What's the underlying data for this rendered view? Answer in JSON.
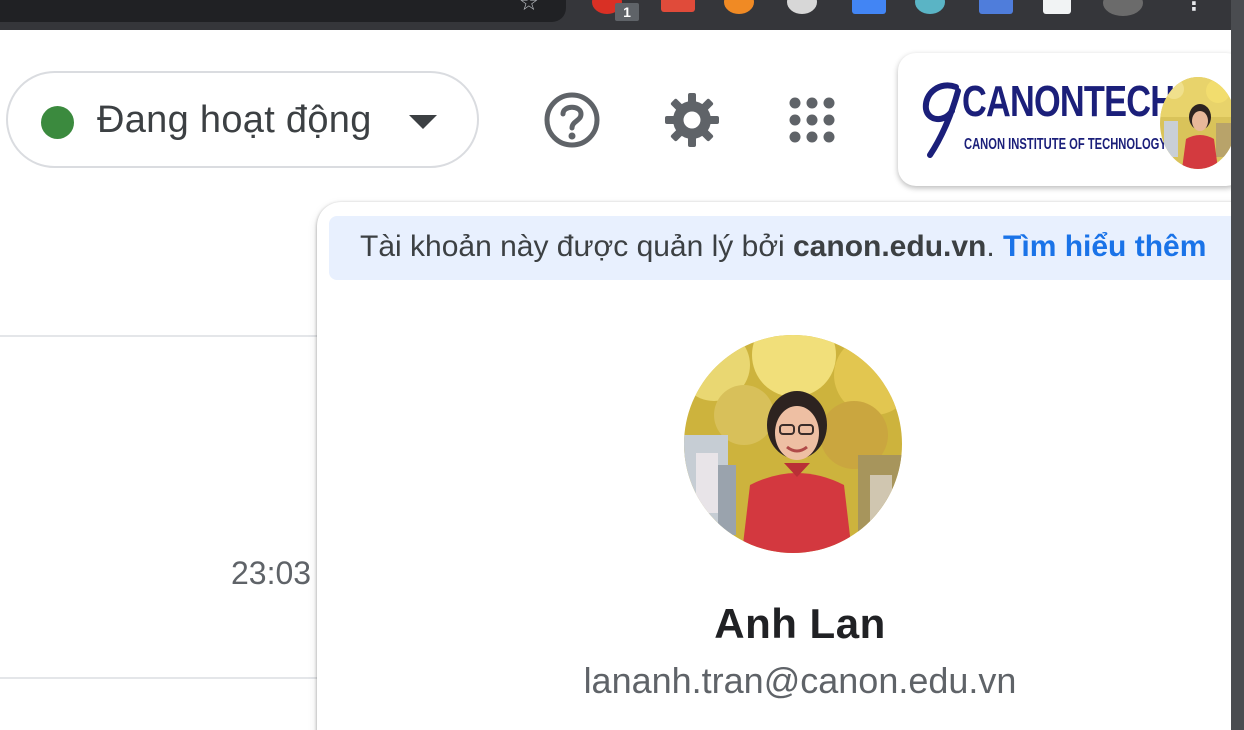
{
  "status": {
    "label": "Đang hoạt động",
    "dot_color": "#3b8a3e",
    "icon": "chevron-down-icon"
  },
  "header_icons": [
    "help-icon",
    "settings-icon",
    "apps-grid-icon"
  ],
  "browser": {
    "extension_badge": "1"
  },
  "org": {
    "logo_word": "CANONTECH",
    "logo_sub": "CANON INSTITUTE OF TECHNOLOGY",
    "logo_color": "#1b1f7a"
  },
  "list": {
    "time": "23:03"
  },
  "account_popup": {
    "managed_prefix": "Tài khoản này được quản lý bởi ",
    "managed_domain": "canon.edu.vn",
    "managed_suffix": ". ",
    "learn_more": "Tìm hiểu thêm",
    "name": "Anh Lan",
    "email": "lananh.tran@canon.edu.vn",
    "link_color": "#1a73e8"
  }
}
